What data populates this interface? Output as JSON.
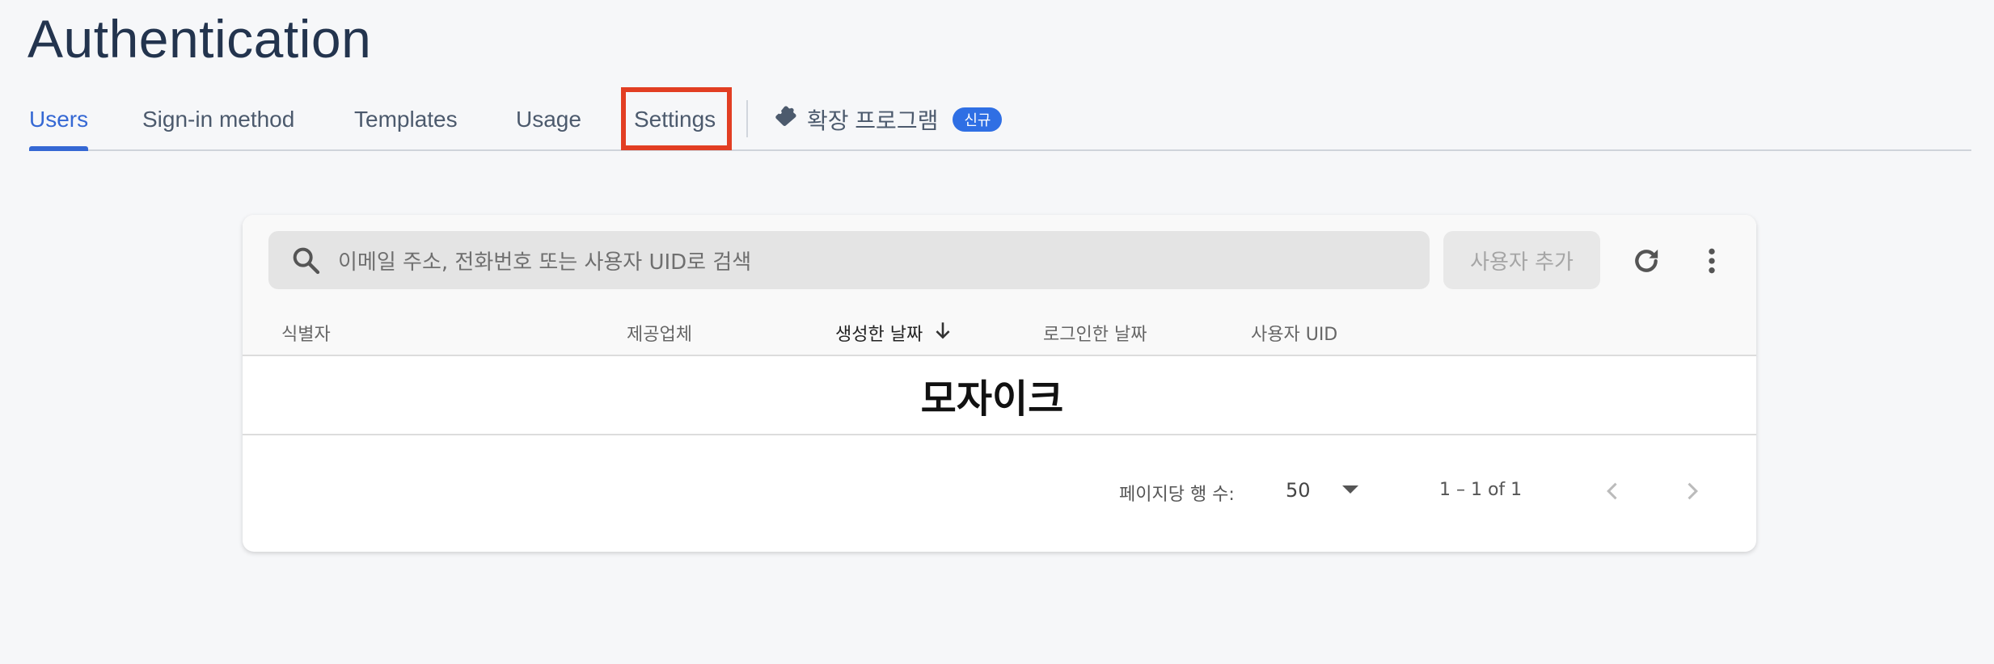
{
  "page": {
    "title": "Authentication"
  },
  "tabs": [
    {
      "label": "Users",
      "active": true
    },
    {
      "label": "Sign-in method",
      "active": false
    },
    {
      "label": "Templates",
      "active": false
    },
    {
      "label": "Usage",
      "active": false
    },
    {
      "label": "Settings",
      "active": false
    }
  ],
  "extensions_tab": {
    "label": "확장 프로그램",
    "badge": "신규",
    "icon": "puzzle-piece-icon"
  },
  "colors": {
    "accent": "#3568d4",
    "highlight": "#e23e23",
    "badge": "#2f6fe4",
    "title": "#23344e"
  },
  "toolbar": {
    "search_placeholder": "이메일 주소, 전화번호 또는 사용자 UID로 검색",
    "add_user_label": "사용자 추가",
    "refresh_icon": "refresh-icon",
    "more_icon": "more-vert-icon"
  },
  "table": {
    "columns": [
      "식별자",
      "제공업체",
      "생성한 날짜",
      "로그인한 날짜",
      "사용자 UID"
    ],
    "sorted_column_icon": "arrow-down-icon",
    "rows": [
      {
        "mosaic": "모자이크"
      }
    ]
  },
  "footer": {
    "rows_per_page_label": "페이지당 행 수:",
    "rows_per_page_value": "50",
    "page_range": "1 – 1 of 1"
  }
}
